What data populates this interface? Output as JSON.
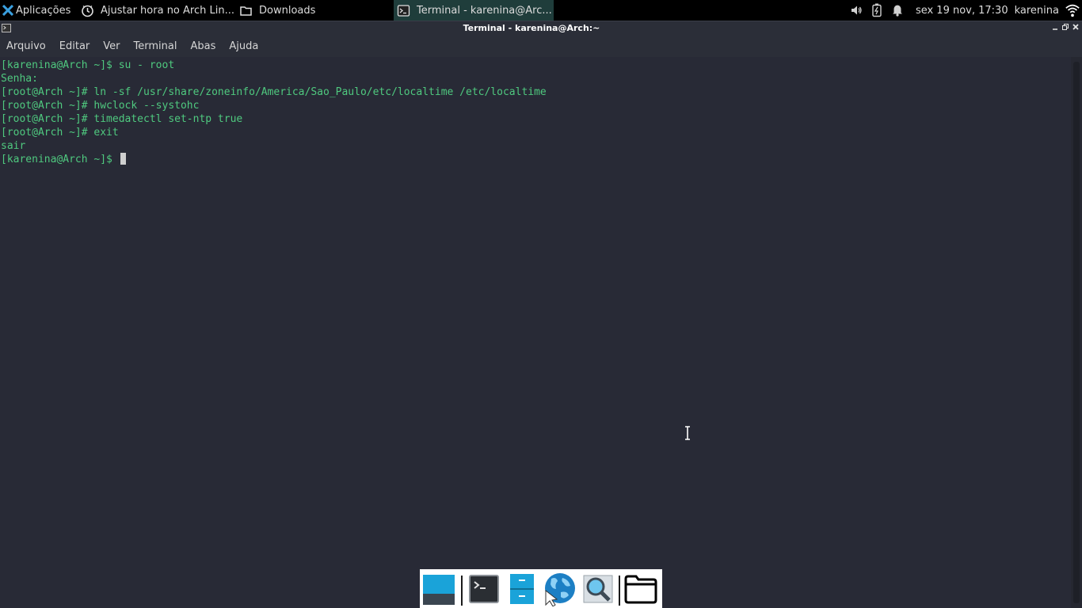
{
  "top_panel": {
    "apps_label": "Aplicações",
    "tasks": [
      {
        "label": "Ajustar hora no Arch Lin...",
        "icon": "clock-icon"
      },
      {
        "label": "Downloads",
        "icon": "folder-icon"
      },
      {
        "label": "Terminal - karenina@Arc...",
        "icon": "terminal-icon"
      }
    ],
    "clock": "sex 19 nov, 17:30",
    "username": "karenina"
  },
  "window": {
    "title": "Terminal - karenina@Arch:~"
  },
  "menu": [
    "Arquivo",
    "Editar",
    "Ver",
    "Terminal",
    "Abas",
    "Ajuda"
  ],
  "terminal": {
    "lines": [
      "[karenina@Arch ~]$ su - root",
      "Senha:",
      "[root@Arch ~]# ln -sf /usr/share/zoneinfo/America/Sao_Paulo/etc/localtime /etc/localtime",
      "[root@Arch ~]# hwclock --systohc",
      "[root@Arch ~]# timedatectl set-ntp true",
      "[root@Arch ~]# exit",
      "sair"
    ],
    "prompt": "[karenina@Arch ~]$ "
  },
  "colors": {
    "terminal_bg": "#282a36",
    "terminal_fg": "#4fc97f",
    "panel_bg": "#000000",
    "active_task_bg": "#1f3d3b"
  }
}
